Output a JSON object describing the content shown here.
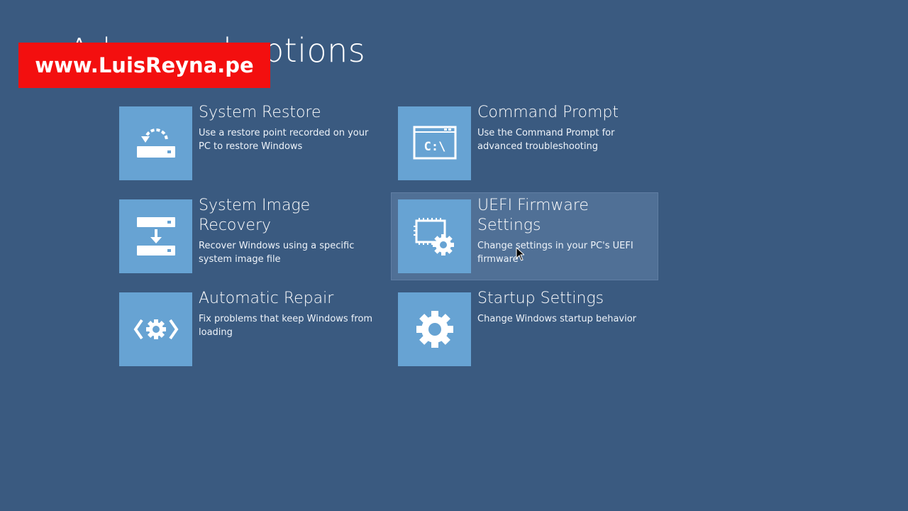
{
  "page": {
    "title": "Advanced options"
  },
  "watermark": {
    "text": "www.LuisReyna.pe"
  },
  "options": [
    {
      "title": "System Restore",
      "description": "Use a restore point recorded on your PC to restore Windows",
      "icon": "system-restore-icon"
    },
    {
      "title": "Command Prompt",
      "description": "Use the Command Prompt for advanced troubleshooting",
      "icon": "command-prompt-icon",
      "icon_text": "C:\\"
    },
    {
      "title": "System Image Recovery",
      "description": "Recover Windows using a specific system image file",
      "icon": "system-image-recovery-icon"
    },
    {
      "title": "UEFI Firmware Settings",
      "description": "Change settings in your PC's UEFI firmware",
      "icon": "uefi-firmware-icon",
      "selected": true
    },
    {
      "title": "Automatic Repair",
      "description": "Fix problems that keep Windows from loading",
      "icon": "automatic-repair-icon"
    },
    {
      "title": "Startup Settings",
      "description": "Change Windows startup behavior",
      "icon": "startup-settings-icon"
    }
  ],
  "colors": {
    "background": "#3a5a80",
    "tile": "#67a3d3",
    "watermark": "#f30f0f"
  }
}
